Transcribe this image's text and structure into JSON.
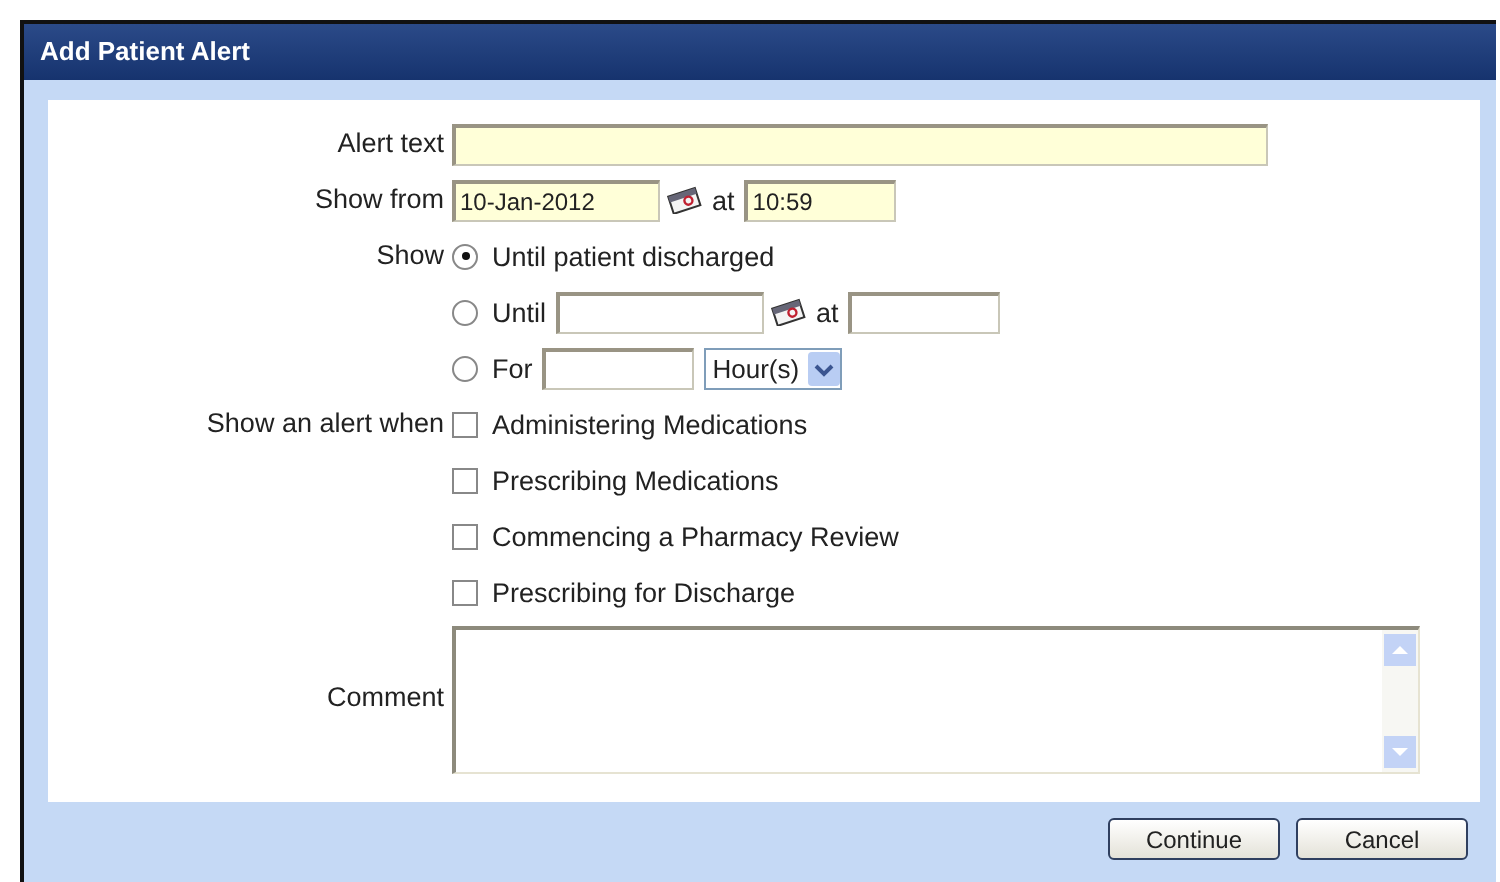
{
  "window": {
    "title": "Add Patient Alert"
  },
  "alert_text": {
    "label": "Alert text"
  },
  "show_from": {
    "label": "Show from",
    "date": "10-Jan-2012",
    "at": "at",
    "time": "10:59"
  },
  "show": {
    "label": "Show",
    "options": [
      {
        "kind": "plain",
        "label": "Until patient discharged",
        "selected": true
      },
      {
        "kind": "date",
        "label": "Until",
        "at": "at",
        "selected": false
      },
      {
        "kind": "duration",
        "label": "For",
        "unit": "Hour(s)",
        "selected": false
      }
    ]
  },
  "alert_when": {
    "label": "Show an alert when",
    "options": [
      {
        "label": "Administering Medications",
        "checked": false
      },
      {
        "label": "Prescribing Medications",
        "checked": false
      },
      {
        "label": "Commencing a Pharmacy Review",
        "checked": false
      },
      {
        "label": "Prescribing for Discharge",
        "checked": false
      }
    ]
  },
  "comment": {
    "label": "Comment"
  },
  "buttons": [
    "Continue",
    "Cancel"
  ]
}
